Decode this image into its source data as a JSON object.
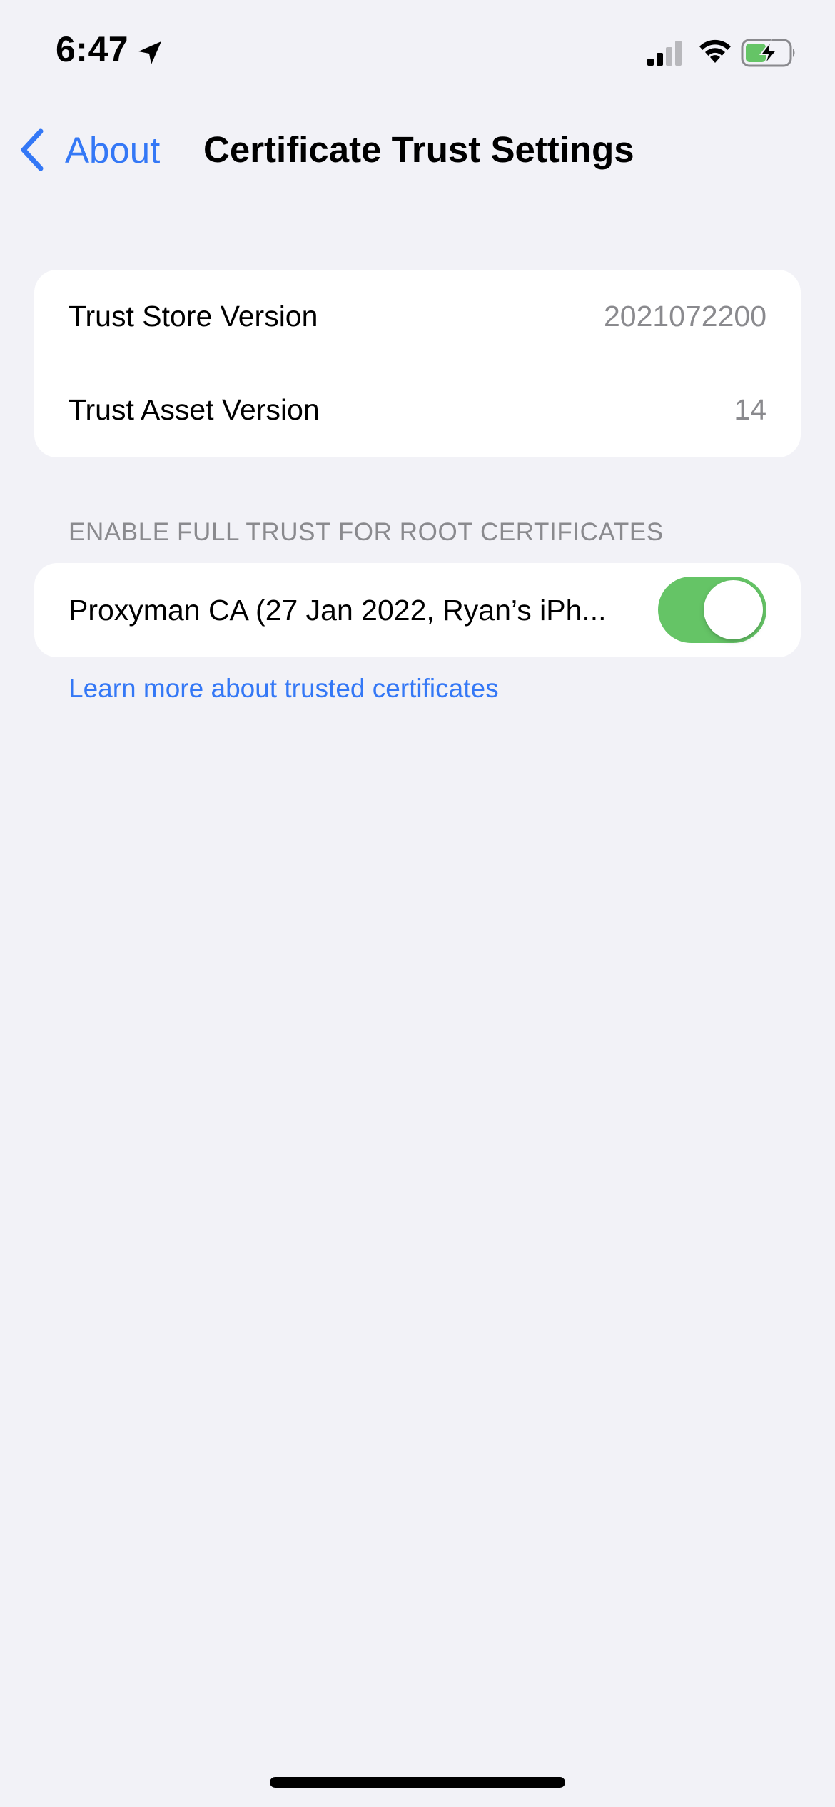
{
  "status_bar": {
    "time": "6:47",
    "icons": [
      "location-arrow-icon",
      "cellular-signal-icon",
      "wifi-icon",
      "battery-charging-icon"
    ]
  },
  "nav": {
    "back_label": "About",
    "title": "Certificate Trust Settings"
  },
  "trust_info": {
    "rows": [
      {
        "label": "Trust Store Version",
        "value": "2021072200"
      },
      {
        "label": "Trust Asset Version",
        "value": "14"
      }
    ]
  },
  "root_certs": {
    "section_header": "ENABLE FULL TRUST FOR ROOT CERTIFICATES",
    "items": [
      {
        "label": "Proxyman CA (27 Jan 2022, Ryan’s iPh...",
        "enabled": true
      }
    ],
    "learn_more": "Learn more about trusted certificates"
  },
  "colors": {
    "accent": "#3478f6",
    "toggle_on": "#65c466",
    "background": "#f2f2f7",
    "secondary_text": "#8a8a8e"
  }
}
